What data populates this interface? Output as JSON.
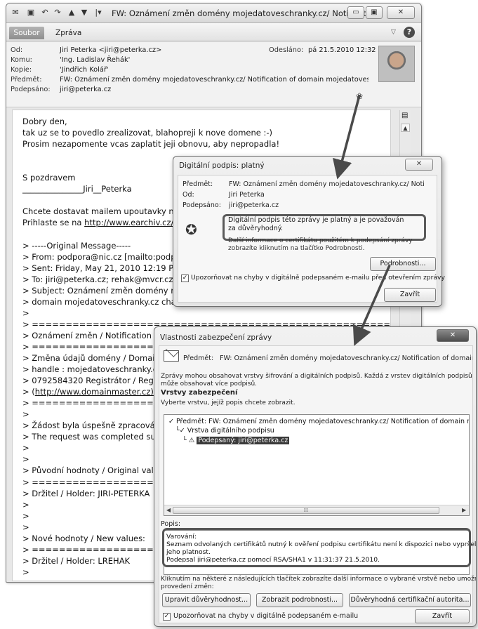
{
  "window": {
    "title": "FW: Oznámení změn domény mojedatoveschranky.cz/ Notificatio...",
    "tabs": [
      "Soubor",
      "Zpráva"
    ]
  },
  "header": {
    "from_label": "Od:",
    "from": "Jiri Peterka <jiri@peterka.cz>",
    "to_label": "Komu:",
    "to": "'Ing. Ladislav Řehák'",
    "cc_label": "Kopie:",
    "cc": "'Jindřich Kolář'",
    "subject_label": "Předmět:",
    "subject": "FW: Oznámení změn domény mojedatoveschranky.cz/ Notification of domain mojedatoveschran",
    "signed_label": "Podepsáno:",
    "signed": "jiri@peterka.cz",
    "sent_label": "Odesláno:",
    "sent": "pá 21.5.2010 12:32"
  },
  "body_lines": [
    "Dobry den,",
    "tak uz se to povedlo zrealizovat, blahopreji k nove domene :-)",
    "Prosim nezapomente vcas zaplatit jeji obnovu, aby nepropadla!",
    "",
    "",
    "S pozdravem",
    "_______________Jiri__Peterka",
    "",
    "Chcete dostavat mailem upoutavky na",
    "Prihlaste se na ",
    "",
    "> -----Original Message-----",
    "> From: podpora@nic.cz [mailto:podpo",
    "> Sent: Friday, May 21, 2010 12:19 PM",
    "> To: jiri@peterka.cz; rehak@mvcr.cz",
    "> Subject: Oznámení změn domény mo",
    "> domain mojedatoveschranky.cz chan",
    ">",
    "> =====================================================================",
    "> Oznámení změn / Notification of",
    "> =====================================================================",
    "> Změna údajů domény / Domain",
    "> handle : mojedatoveschranky.cz",
    "> 0792584320 Registrátor / Registr",
    "> (",
    "> =====================================================================",
    ">",
    "> Žádost byla úspešně zpracována",
    "> The request was completed suc",
    ">",
    ">",
    "> Původní hodnoty / Original value",
    "> =====================================================================",
    "> Držitel / Holder: JIRI-PETERKA",
    ">",
    ">",
    ">",
    "> Nové hodnoty / New values:",
    "> =====================================================================",
    "> Držitel / Holder: LREHAK",
    ">"
  ],
  "body_links": {
    "earchiv": "http://www.earchiv.cz/",
    "domainmaster": "http://www.domainmaster.cz)"
  },
  "sig_dialog": {
    "title": "Digitální podpis: platný",
    "subject_label": "Předmět:",
    "subject": "FW: Oznámení změn domény mojedatoveschranky.cz/ Noti",
    "from_label": "Od:",
    "from": "Jiri Peterka",
    "signed_label": "Podepsáno:",
    "signed": "jiri@peterka.cz",
    "valid_msg": "Digitální podpis této zprávy je platný a je považován za důvěryhodný.",
    "info_msg": "Další informace o certifikátu použitém k podepsání zprávy zobrazíte kliknutím na tlačítko Podrobnosti.",
    "details_button": "Podrobnosti...",
    "warn_checkbox": "Upozorňovat na chyby v digitálně podepsaném e-mailu před otevřením zprávy",
    "close_button": "Zavřít"
  },
  "sec_dialog": {
    "title": "Vlastnosti zabezpečení zprávy",
    "subject_label": "Předmět:",
    "subject": "FW: Oznámení změn domény mojedatoveschranky.cz/ Notification of domain moje",
    "info1": "Zprávy mohou obsahovat vrstvy šifrování a digitálních podpisů. Každá z vrstev digitálních podpisů",
    "info2": "může obsahovat více podpisů.",
    "layers_heading": "Vrstvy zabezpečení",
    "layers_hint": "Vyberte vrstvu, jejíž popis chcete zobrazit.",
    "tree": [
      "Předmět: FW: Oznámení změn domény mojedatoveschranky.cz/ Notification of domain mojedatov",
      "Vrstva digitálního podpisu",
      "Podepsaný: jiri@peterka.cz"
    ],
    "desc_label": "Popis:",
    "desc_lines": [
      "Varování:",
      "Seznam odvolaných certifikátů nutný k ověření podpisu certifikátu není k dispozici nebo vypršela",
      "jeho platnost.",
      "Podepsal jiri@peterka.cz pomocí RSA/SHA1 v 11:31:37 21.5.2010."
    ],
    "click_info1": "Kliknutím na některé z následujících tlačítek zobrazíte další informace o vybrané vrstvě nebo umožníte",
    "click_info2": "provedení změn:",
    "btn_trust": "Upravit důvěryhodnost...",
    "btn_details": "Zobrazit podrobnosti...",
    "btn_ca": "Důvěryhodná certifikační autorita...",
    "warn_checkbox": "Upozorňovat na chyby v digitálně podepsaném e-mailu",
    "close_button": "Zavřít"
  },
  "colors": {
    "highlight_border": "#555555",
    "selected_tree_bg": "#3a3a3a"
  }
}
